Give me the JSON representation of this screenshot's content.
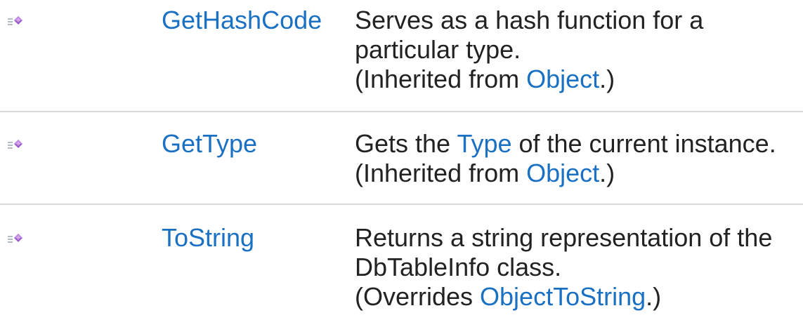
{
  "members": [
    {
      "icon": "public-method-icon",
      "name": "GetHashCode",
      "description": [
        {
          "text": "Serves as a hash function for a"
        },
        {
          "text": "particular type."
        },
        {
          "prefix": "(Inherited from ",
          "link": "Object",
          "suffix": ".)"
        }
      ]
    },
    {
      "icon": "public-method-icon",
      "name": "GetType",
      "description": [
        {
          "prefix": "Gets the ",
          "link": "Type",
          "suffix": " of the current instance."
        },
        {
          "prefix": "(Inherited from ",
          "link": "Object",
          "suffix": ".)"
        }
      ]
    },
    {
      "icon": "public-method-icon",
      "name": "ToString",
      "description": [
        {
          "text": "Returns a string representation of the"
        },
        {
          "text": "DbTableInfo class."
        },
        {
          "prefix": "(Overrides ",
          "link": "ObjectToString",
          "suffix": ".)"
        }
      ]
    }
  ],
  "colors": {
    "link": "#1a70c2",
    "text": "#222222",
    "divider": "#d9d9d9",
    "icon_purple": "#9b59c8"
  }
}
